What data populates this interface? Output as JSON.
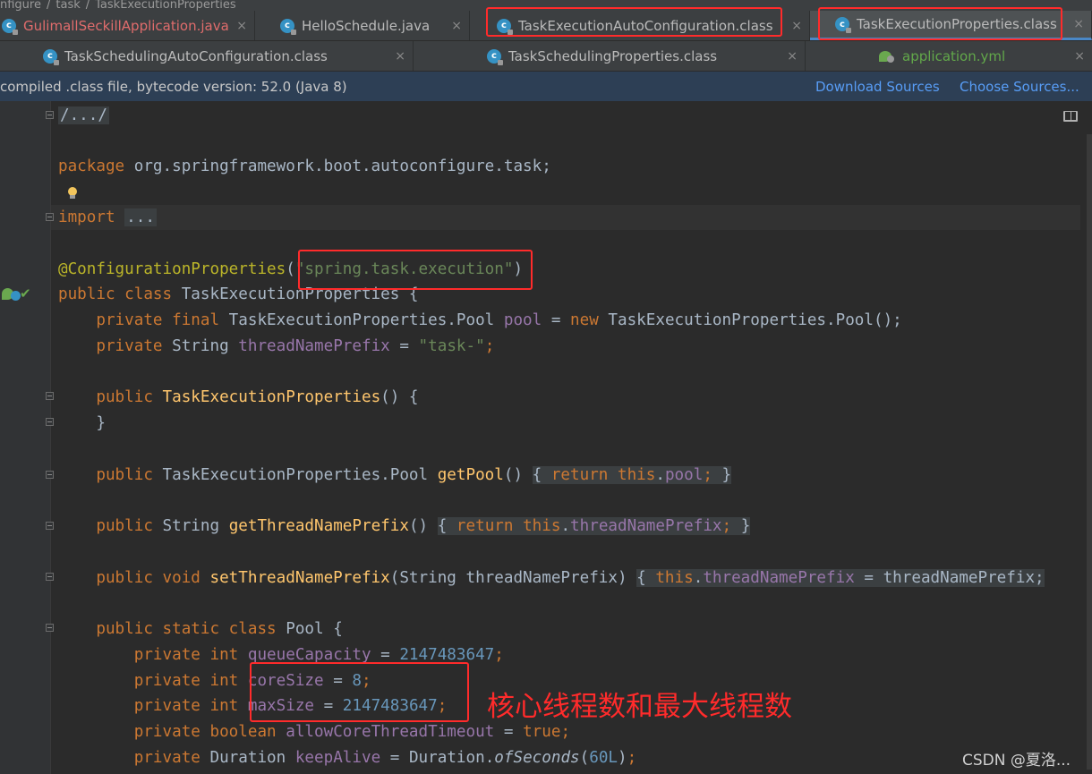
{
  "breadcrumb": [
    "nfigure",
    "/",
    "task",
    "/",
    "TaskExecutionProperties"
  ],
  "tabs_row1": [
    {
      "label": "GulimallSeckillApplication.java",
      "icon": "java-class-icon",
      "style": "red"
    },
    {
      "label": "HelloSchedule.java",
      "icon": "java-class-icon",
      "style": "normal"
    },
    {
      "label": "TaskExecutionAutoConfiguration.class",
      "icon": "class-file-icon",
      "style": "normal"
    },
    {
      "label": "TaskExecutionProperties.class",
      "icon": "class-file-icon",
      "style": "active"
    }
  ],
  "tabs_row2": [
    {
      "label": "TaskSchedulingAutoConfiguration.class",
      "icon": "class-file-icon"
    },
    {
      "label": "TaskSchedulingProperties.class",
      "icon": "class-file-icon"
    },
    {
      "label": "application.yml",
      "icon": "spring-yaml-icon"
    }
  ],
  "close_glyph": "×",
  "notice": {
    "message": "compiled .class file, bytecode version: 52.0 (Java 8)",
    "download_sources": "Download Sources",
    "choose_sources": "Choose Sources..."
  },
  "code": {
    "header_fold": "/.../",
    "package_kw": "package",
    "package_name": " org.springframework.boot.autoconfigure.task;",
    "import_kw": "import",
    "import_fold": "...",
    "annotation": "@ConfigurationProperties",
    "annotation_value": "\"spring.task.execution\"",
    "class_decl": "TaskExecutionProperties {",
    "pool_type": "TaskExecutionProperties.Pool",
    "pool_field": "pool",
    "pool_init": "TaskExecutionProperties.Pool();",
    "prefix_field": "threadNamePrefix",
    "prefix_value": "\"task-\"",
    "ctor_name": "TaskExecutionProperties",
    "getpool_name": "getPool",
    "getprefix_name": "getThreadNamePrefix",
    "setprefix_name": "setThreadNamePrefix",
    "setprefix_param": "(String threadNamePrefix)",
    "setprefix_rhs": " = threadNamePrefix;",
    "pool_class": "Pool {",
    "queue_field": "queueCapacity",
    "queue_value": "2147483647",
    "core_field": "coreSize",
    "core_value": "8",
    "max_field": "maxSize",
    "max_value": "2147483647",
    "allow_field": "allowCoreThreadTimeout",
    "allow_value": "true",
    "keep_field": "keepAlive",
    "keep_method": "ofSeconds",
    "keep_value": "60L"
  },
  "annotation_text": "核心线程数和最大线程数",
  "watermark": "CSDN @夏洛...",
  "colors": {
    "highlight_box": "#ff2b2b",
    "keyword": "#cc7832",
    "string": "#6a8759",
    "number": "#6897bb",
    "field": "#9876aa",
    "method": "#ffc66d"
  }
}
